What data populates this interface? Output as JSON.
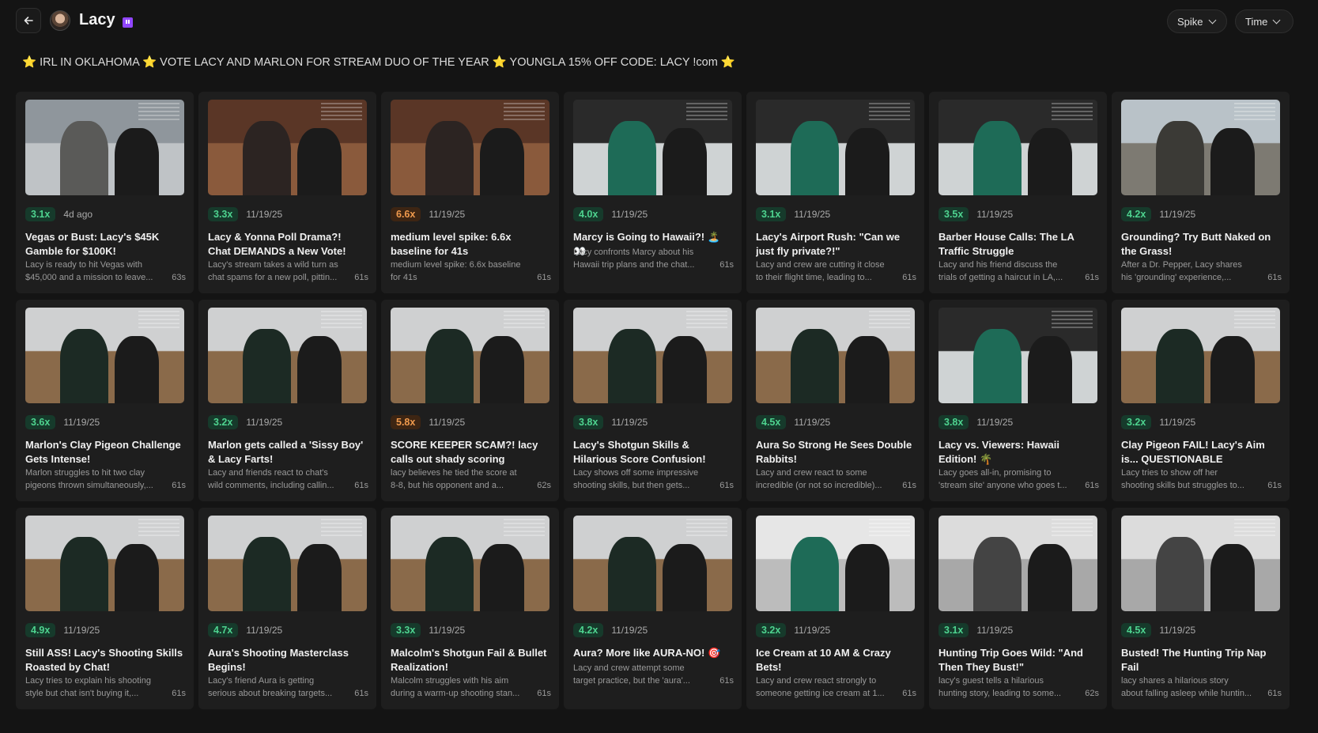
{
  "header": {
    "channel_name": "Lacy",
    "filters": [
      {
        "label": "Spike"
      },
      {
        "label": "Time"
      }
    ],
    "stream_title": "⭐ IRL IN OKLAHOMA ⭐ VOTE LACY AND MARLON FOR STREAM DUO OF THE YEAR ⭐ YOUNGLA 15% OFF CODE: LACY !com ⭐"
  },
  "colors": {
    "background": "#141414",
    "card": "#1e1e1e",
    "badge_green_text": "#4ed38f",
    "badge_orange_text": "#f09a4d",
    "twitch_purple": "#9146ff"
  },
  "clips": [
    {
      "spike": "3.1x",
      "level": "green",
      "date": "4d ago",
      "title": "Vegas or Bust: Lacy's $45K Gamble for $100K!",
      "desc1": "Lacy is ready to hit Vegas with",
      "desc2": "$45,000 and a mission to leave...",
      "duration": "63s",
      "scene": "street"
    },
    {
      "spike": "3.3x",
      "level": "green",
      "date": "11/19/25",
      "title": "Lacy & Yonna Poll Drama?! Chat DEMANDS a New Vote!",
      "desc1": "Lacy's stream takes a wild turn as",
      "desc2": "chat spams for a new poll, pittin...",
      "duration": "61s",
      "scene": "bar"
    },
    {
      "spike": "6.6x",
      "level": "orange",
      "date": "11/19/25",
      "title": "medium level spike: 6.6x baseline for 41s",
      "desc1": "medium level spike: 6.6x baseline",
      "desc2": "for 41s",
      "duration": "61s",
      "scene": "bar"
    },
    {
      "spike": "4.0x",
      "level": "green",
      "date": "11/19/25",
      "title": "Marcy is Going to Hawaii?! 🏝️👀",
      "desc1": "Lacy confronts Marcy about his",
      "desc2": "Hawaii trip plans and the chat...",
      "duration": "61s",
      "scene": "car",
      "short": true
    },
    {
      "spike": "3.1x",
      "level": "green",
      "date": "11/19/25",
      "title": "Lacy's Airport Rush: \"Can we just fly private?!\"",
      "desc1": "Lacy and crew are cutting it close",
      "desc2": "to their flight time, leading to...",
      "duration": "61s",
      "scene": "car"
    },
    {
      "spike": "3.5x",
      "level": "green",
      "date": "11/19/25",
      "title": "Barber House Calls: The LA Traffic Struggle",
      "desc1": "Lacy and his friend discuss the",
      "desc2": "trials of getting a haircut in LA,...",
      "duration": "61s",
      "scene": "car"
    },
    {
      "spike": "4.2x",
      "level": "green",
      "date": "11/19/25",
      "title": "Grounding? Try Butt Naked on the Grass!",
      "desc1": "After a Dr. Pepper, Lacy shares",
      "desc2": "his 'grounding' experience,...",
      "duration": "61s",
      "scene": "yard"
    },
    {
      "spike": "3.6x",
      "level": "green",
      "date": "11/19/25",
      "title": "Marlon's Clay Pigeon Challenge Gets Intense!",
      "desc1": "Marlon struggles to hit two clay",
      "desc2": "pigeons thrown simultaneously,...",
      "duration": "61s",
      "scene": "field"
    },
    {
      "spike": "3.2x",
      "level": "green",
      "date": "11/19/25",
      "title": "Marlon gets called a 'Sissy Boy' & Lacy Farts!",
      "desc1": "Lacy and friends react to chat's",
      "desc2": "wild comments, including callin...",
      "duration": "61s",
      "scene": "field"
    },
    {
      "spike": "5.8x",
      "level": "orange",
      "date": "11/19/25",
      "title": "SCORE KEEPER SCAM?! lacy calls out shady scoring",
      "desc1": "lacy believes he tied the score at",
      "desc2": "8-8, but his opponent and a...",
      "duration": "62s",
      "scene": "field"
    },
    {
      "spike": "3.8x",
      "level": "green",
      "date": "11/19/25",
      "title": "Lacy's Shotgun Skills & Hilarious Score Confusion!",
      "desc1": "Lacy shows off some impressive",
      "desc2": "shooting skills, but then gets...",
      "duration": "61s",
      "scene": "field"
    },
    {
      "spike": "4.5x",
      "level": "green",
      "date": "11/19/25",
      "title": "Aura So Strong He Sees Double Rabbits!",
      "desc1": "Lacy and crew react to some",
      "desc2": "incredible (or not so incredible)...",
      "duration": "61s",
      "scene": "field"
    },
    {
      "spike": "3.8x",
      "level": "green",
      "date": "11/19/25",
      "title": "Lacy vs. Viewers: Hawaii Edition! 🌴",
      "desc1": "Lacy goes all-in, promising to",
      "desc2": "'stream site' anyone who goes t...",
      "duration": "61s",
      "scene": "car"
    },
    {
      "spike": "3.2x",
      "level": "green",
      "date": "11/19/25",
      "title": "Clay Pigeon FAIL! Lacy's Aim is... QUESTIONABLE",
      "desc1": "Lacy tries to show off her",
      "desc2": "shooting skills but struggles to...",
      "duration": "61s",
      "scene": "field"
    },
    {
      "spike": "4.9x",
      "level": "green",
      "date": "11/19/25",
      "title": "Still ASS! Lacy's Shooting Skills Roasted by Chat!",
      "desc1": "Lacy tries to explain his shooting",
      "desc2": "style but chat isn't buying it,...",
      "duration": "61s",
      "scene": "field"
    },
    {
      "spike": "4.7x",
      "level": "green",
      "date": "11/19/25",
      "title": "Aura's Shooting Masterclass Begins!",
      "desc1": "Lacy's friend Aura is getting",
      "desc2": "serious about breaking targets...",
      "duration": "61s",
      "scene": "field"
    },
    {
      "spike": "3.3x",
      "level": "green",
      "date": "11/19/25",
      "title": "Malcolm's Shotgun Fail & Bullet Realization!",
      "desc1": "Malcolm struggles with his aim",
      "desc2": "during a warm-up shooting stan...",
      "duration": "61s",
      "scene": "field"
    },
    {
      "spike": "4.2x",
      "level": "green",
      "date": "11/19/25",
      "title": "Aura? More like AURA-NO! 🎯",
      "desc1": "Lacy and crew attempt some",
      "desc2": "target practice, but the 'aura'...",
      "duration": "61s",
      "scene": "field",
      "short": true
    },
    {
      "spike": "3.2x",
      "level": "green",
      "date": "11/19/25",
      "title": "Ice Cream at 10 AM & Crazy Bets!",
      "desc1": "Lacy and crew react strongly to",
      "desc2": "someone getting ice cream at 1...",
      "duration": "61s",
      "scene": "office"
    },
    {
      "spike": "3.1x",
      "level": "green",
      "date": "11/19/25",
      "title": "Hunting Trip Goes Wild: \"And Then They Bust!\"",
      "desc1": "lacy's guest tells a hilarious",
      "desc2": "hunting story, leading to some...",
      "duration": "62s",
      "scene": "drive"
    },
    {
      "spike": "4.5x",
      "level": "green",
      "date": "11/19/25",
      "title": "Busted! The Hunting Trip Nap Fail",
      "desc1": "lacy shares a hilarious story",
      "desc2": "about falling asleep while huntin...",
      "duration": "61s",
      "scene": "drive"
    }
  ]
}
